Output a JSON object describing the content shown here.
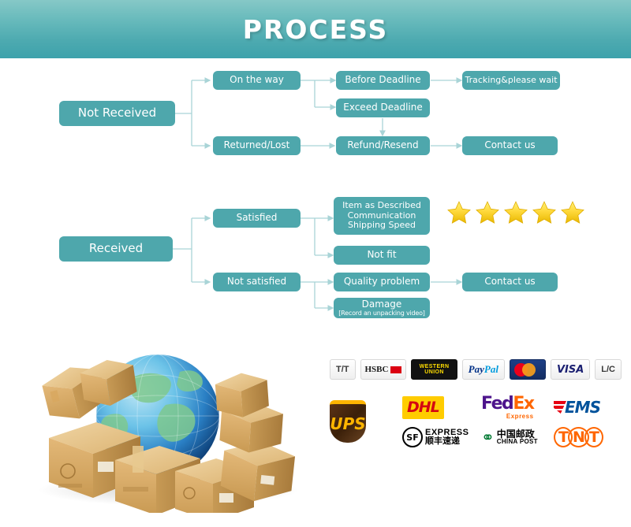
{
  "header": {
    "title": "PROCESS",
    "gradient_top": "#86c8c7",
    "gradient_bottom": "#3da2ab"
  },
  "theme": {
    "node_color": "#4ea7ac",
    "line_color": "#a9d4d7",
    "star_color": "#f5c518",
    "text_color": "#ffffff"
  },
  "flow": {
    "not_received": {
      "root": {
        "label": "Not Received"
      },
      "nodes": [
        {
          "label": "On the way"
        },
        {
          "label": "Before Deadline"
        },
        {
          "label": "Tracking&please wait"
        },
        {
          "label": "Exceed Deadline"
        },
        {
          "label": "Returned/Lost"
        },
        {
          "label": "Refund/Resend"
        },
        {
          "label": "Contact us"
        }
      ]
    },
    "received": {
      "root": {
        "label": "Received"
      },
      "nodes": [
        {
          "label": "Satisfied"
        },
        {
          "label": "Item as Described",
          "line2": "Communication",
          "line3": "Shipping Speed"
        },
        {
          "label": "Not fit"
        },
        {
          "label": "Not satisfied"
        },
        {
          "label": "Quality problem"
        },
        {
          "label": "Contact us"
        },
        {
          "label": "Damage",
          "sub": "[Record an unpacking video]"
        }
      ]
    },
    "rating": {
      "stars": 5
    }
  },
  "payments": [
    {
      "name": "T/T",
      "label": "T/T"
    },
    {
      "name": "HSBC",
      "label": "HSBC"
    },
    {
      "name": "WESTERN UNION",
      "label": "WESTERN UNION"
    },
    {
      "name": "PayPal",
      "label": "PayPal"
    },
    {
      "name": "MasterCard",
      "label": "MasterCard"
    },
    {
      "name": "VISA",
      "label": "VISA"
    },
    {
      "name": "L/C",
      "label": "L/C"
    }
  ],
  "shipping": [
    {
      "name": "DHL",
      "label": "DHL"
    },
    {
      "name": "FedEx",
      "label": "FedEx",
      "sub": "Express"
    },
    {
      "name": "EMS",
      "label": "EMS"
    },
    {
      "name": "UPS",
      "label": "UPS"
    },
    {
      "name": "SF Express",
      "label": "SF",
      "en": "EXPRESS",
      "cn": "顺丰速递"
    },
    {
      "name": "China Post",
      "label": "中国邮政",
      "en": "CHINA POST"
    },
    {
      "name": "TNT",
      "label": "TNT"
    }
  ]
}
